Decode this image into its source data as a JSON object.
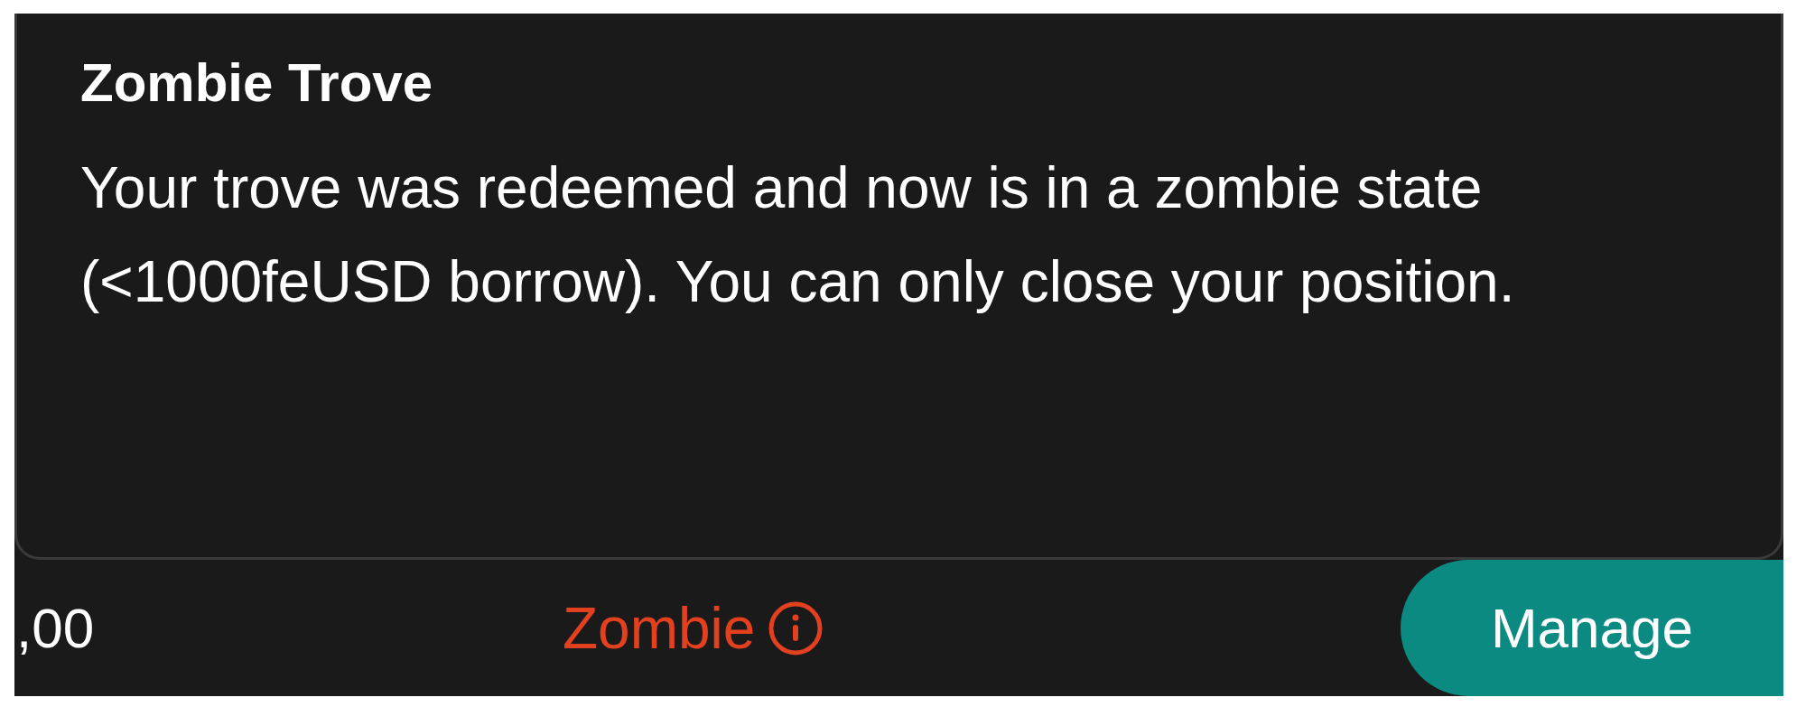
{
  "tooltip": {
    "title": "Zombie Trove",
    "body": "Your trove was redeemed and now is in a zombie state (<1000feUSD borrow). You can only close your position."
  },
  "row": {
    "amount": ",00",
    "status": "Zombie",
    "manage_button": "Manage"
  }
}
